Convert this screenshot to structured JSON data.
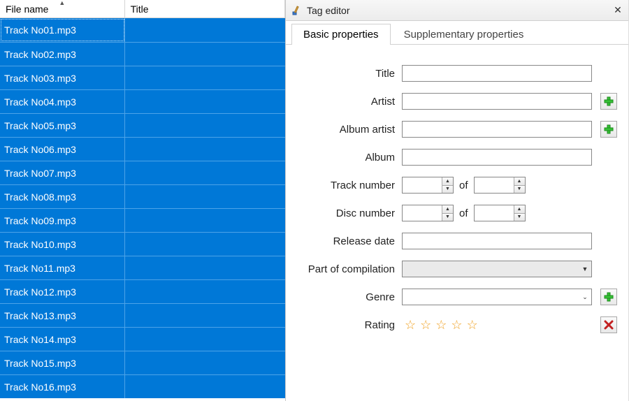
{
  "file_list": {
    "columns": {
      "filename": "File name",
      "title": "Title"
    },
    "sort_column": "filename",
    "rows": [
      {
        "filename": "Track No01.mp3",
        "title": "",
        "focused": true
      },
      {
        "filename": "Track No02.mp3",
        "title": ""
      },
      {
        "filename": "Track No03.mp3",
        "title": ""
      },
      {
        "filename": "Track No04.mp3",
        "title": ""
      },
      {
        "filename": "Track No05.mp3",
        "title": ""
      },
      {
        "filename": "Track No06.mp3",
        "title": ""
      },
      {
        "filename": "Track No07.mp3",
        "title": ""
      },
      {
        "filename": "Track No08.mp3",
        "title": ""
      },
      {
        "filename": "Track No09.mp3",
        "title": ""
      },
      {
        "filename": "Track No10.mp3",
        "title": ""
      },
      {
        "filename": "Track No11.mp3",
        "title": ""
      },
      {
        "filename": "Track No12.mp3",
        "title": ""
      },
      {
        "filename": "Track No13.mp3",
        "title": ""
      },
      {
        "filename": "Track No14.mp3",
        "title": ""
      },
      {
        "filename": "Track No15.mp3",
        "title": ""
      },
      {
        "filename": "Track No16.mp3",
        "title": ""
      }
    ]
  },
  "editor": {
    "title": "Tag editor",
    "tabs": {
      "basic": "Basic properties",
      "supplementary": "Supplementary properties"
    },
    "active_tab": "basic",
    "labels": {
      "title": "Title",
      "artist": "Artist",
      "album_artist": "Album artist",
      "album": "Album",
      "track_number": "Track number",
      "disc_number": "Disc number",
      "release_date": "Release date",
      "compilation": "Part of compilation",
      "genre": "Genre",
      "rating": "Rating",
      "of": "of"
    },
    "values": {
      "title": "",
      "artist": "",
      "album_artist": "",
      "album": "",
      "track_no": "",
      "track_total": "",
      "disc_no": "",
      "disc_total": "",
      "release_date": "",
      "compilation": "",
      "genre": "",
      "rating": 0
    }
  }
}
